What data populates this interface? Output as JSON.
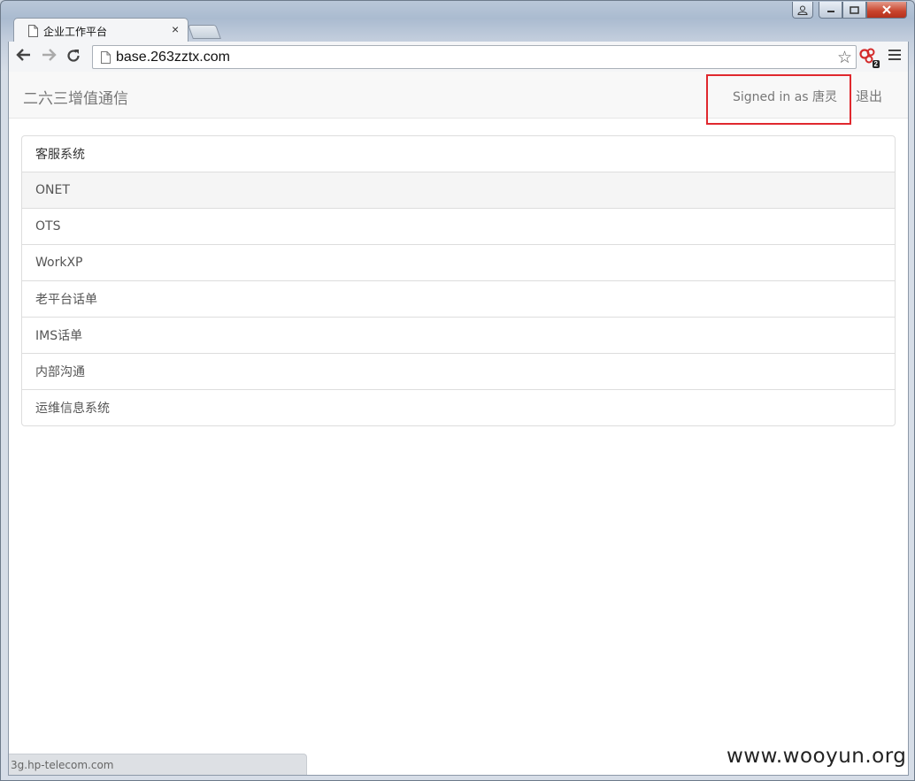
{
  "browser": {
    "tab_title": "企业工作平台",
    "tab_close": "×",
    "url": "base.263zztx.com",
    "extension_badge": "2",
    "window_controls": {
      "min": "▁",
      "max": "▢",
      "close": "✕",
      "user": "👤"
    }
  },
  "navbar": {
    "brand": "二六三增值通信",
    "signed_in_text": "Signed in as 唐灵",
    "logout_label": "退出"
  },
  "systems": [
    {
      "label": "客服系统",
      "active": false
    },
    {
      "label": "ONET",
      "active": true
    },
    {
      "label": "OTS",
      "active": false
    },
    {
      "label": "WorkXP",
      "active": false
    },
    {
      "label": "老平台话单",
      "active": false
    },
    {
      "label": "IMS话单",
      "active": false
    },
    {
      "label": "内部沟通",
      "active": false
    },
    {
      "label": "运维信息系统",
      "active": false
    }
  ],
  "status_bar": "3g.hp-telecom.com",
  "watermark": "www.wooyun.org",
  "colors": {
    "highlight": "#e0282e",
    "navbar_bg": "#f8f8f8",
    "active_row": "#f5f5f5"
  }
}
